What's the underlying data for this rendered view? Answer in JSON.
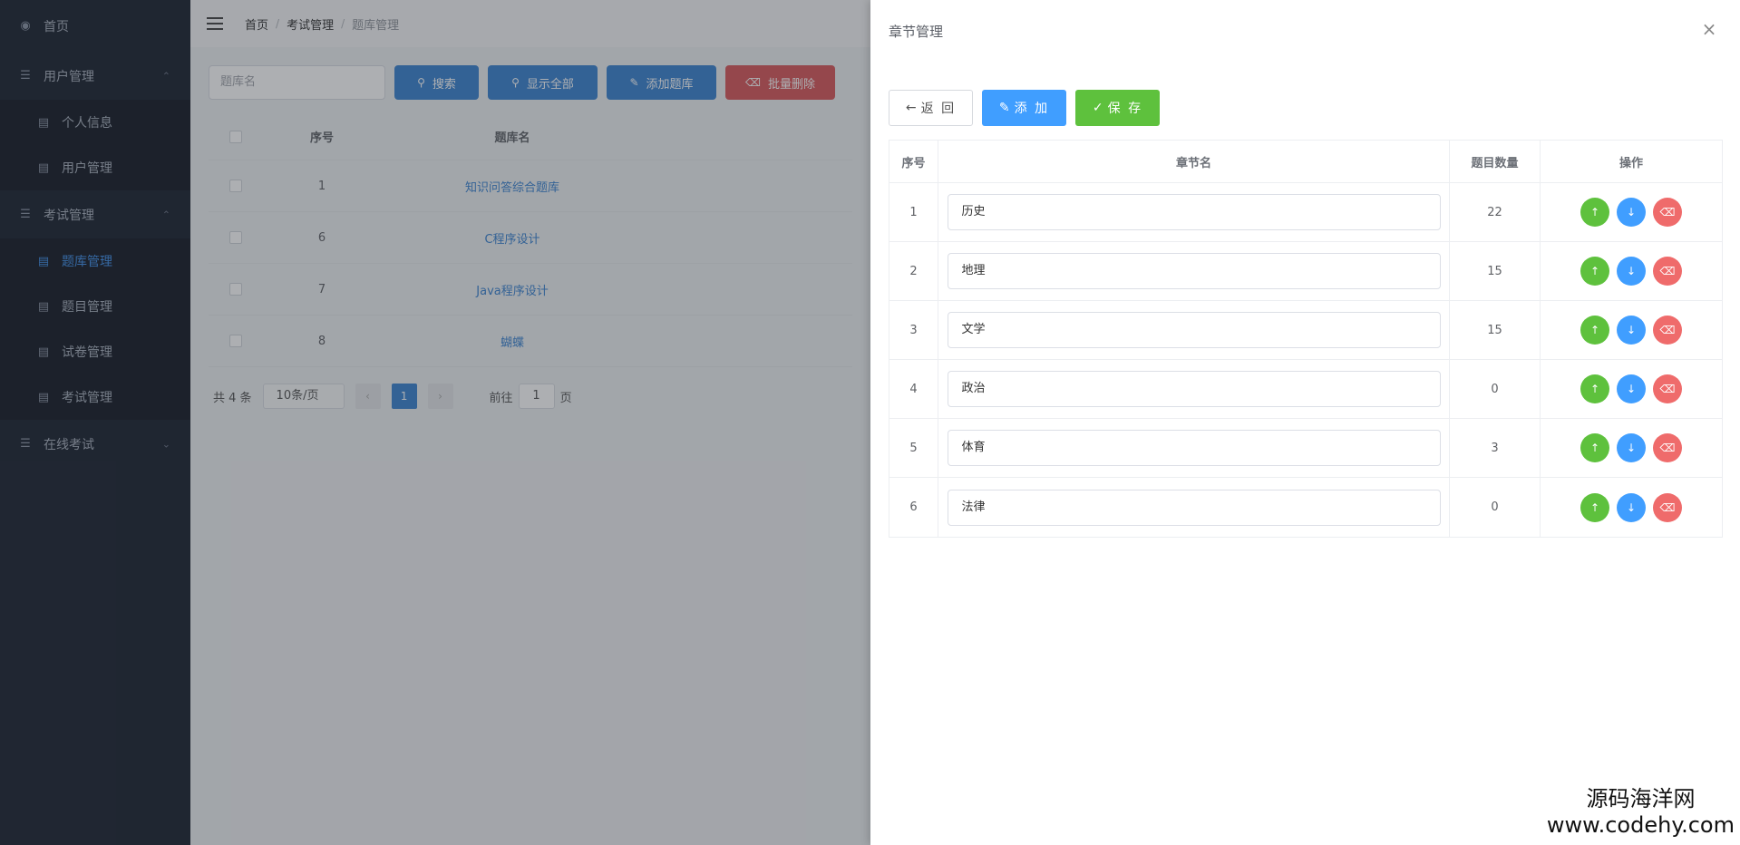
{
  "sidebar": {
    "items": [
      {
        "label": "首页",
        "icon": "dashboard-icon"
      },
      {
        "label": "用户管理",
        "icon": "list-icon",
        "children": [
          {
            "label": "个人信息"
          },
          {
            "label": "用户管理"
          }
        ]
      },
      {
        "label": "考试管理",
        "icon": "list-icon",
        "children": [
          {
            "label": "题库管理",
            "active": true
          },
          {
            "label": "题目管理"
          },
          {
            "label": "试卷管理"
          },
          {
            "label": "考试管理"
          }
        ]
      },
      {
        "label": "在线考试",
        "icon": "list-icon"
      }
    ]
  },
  "breadcrumb": [
    "首页",
    "考试管理",
    "题库管理"
  ],
  "main": {
    "search_placeholder": "题库名",
    "buttons": {
      "search": "搜索",
      "show_all": "显示全部",
      "add_bank": "添加题库",
      "batch_delete": "批量删除"
    },
    "table": {
      "headers": [
        "序号",
        "题库名"
      ],
      "rows": [
        {
          "no": "1",
          "name": "知识问答综合题库"
        },
        {
          "no": "6",
          "name": "C程序设计"
        },
        {
          "no": "7",
          "name": "Java程序设计"
        },
        {
          "no": "8",
          "name": "蝴蝶"
        }
      ]
    },
    "pager": {
      "total": "共 4 条",
      "page_size": "10条/页",
      "prev": "‹",
      "current": "1",
      "next": "›",
      "goto_label": "前往",
      "goto_value": "1",
      "page_suffix": "页"
    }
  },
  "drawer": {
    "title": "章节管理",
    "close": "×",
    "buttons": {
      "back": "返 回",
      "add": "添 加",
      "save": "保 存"
    },
    "headers": [
      "序号",
      "章节名",
      "题目数量",
      "操作"
    ],
    "rows": [
      {
        "no": "1",
        "name": "历史",
        "count": "22"
      },
      {
        "no": "2",
        "name": "地理",
        "count": "15"
      },
      {
        "no": "3",
        "name": "文学",
        "count": "15"
      },
      {
        "no": "4",
        "name": "政治",
        "count": "0"
      },
      {
        "no": "5",
        "name": "体育",
        "count": "3"
      },
      {
        "no": "6",
        "name": "法律",
        "count": "0"
      }
    ]
  },
  "watermark": {
    "line1": "源码海洋网",
    "line2": "www.codehy.com"
  },
  "colors": {
    "primary": "#409eff",
    "success": "#5ec13d",
    "danger": "#ef6b6b",
    "sidebar": "#1b2230"
  }
}
